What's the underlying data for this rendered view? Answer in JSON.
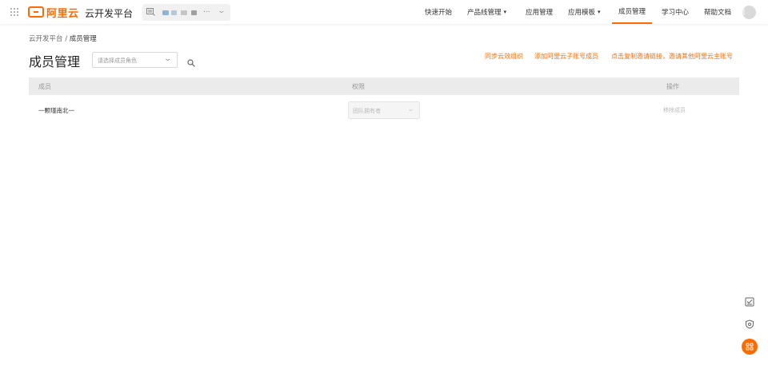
{
  "header": {
    "brand": "阿里云",
    "platform_title": "云开发平台",
    "org_selector": {
      "ellipsis": "..."
    },
    "nav": [
      {
        "label": "快速开始",
        "has_dropdown": false
      },
      {
        "label": "产品线管理",
        "has_dropdown": true
      },
      {
        "label": "应用管理",
        "has_dropdown": false
      },
      {
        "label": "应用模板",
        "has_dropdown": true
      },
      {
        "label": "成员管理",
        "has_dropdown": false,
        "active": true
      },
      {
        "label": "学习中心",
        "has_dropdown": false
      },
      {
        "label": "帮助文档",
        "has_dropdown": false
      }
    ],
    "icons": {
      "menu": "grid-icon",
      "avatar": "avatar"
    }
  },
  "breadcrumb": {
    "parent": "云开发平台",
    "separator": "/",
    "current": "成员管理"
  },
  "page": {
    "title": "成员管理",
    "role_select": {
      "placeholder": "请选择成员角色"
    },
    "actions": {
      "sync": "同步云效组织",
      "add_sub_account": "添加阿里云子账号成员",
      "invite": "点击复制邀请链接，邀请其他阿里云主账号"
    }
  },
  "table": {
    "columns": {
      "member": "成员",
      "permission": "权限",
      "operation": "操作"
    },
    "rows": [
      {
        "member": "一颗瑾南北一",
        "permission": "团队拥有者",
        "operation": "移除成员"
      }
    ]
  },
  "colors": {
    "accent": "#ff6a00",
    "header_bg": "#ebebeb"
  }
}
